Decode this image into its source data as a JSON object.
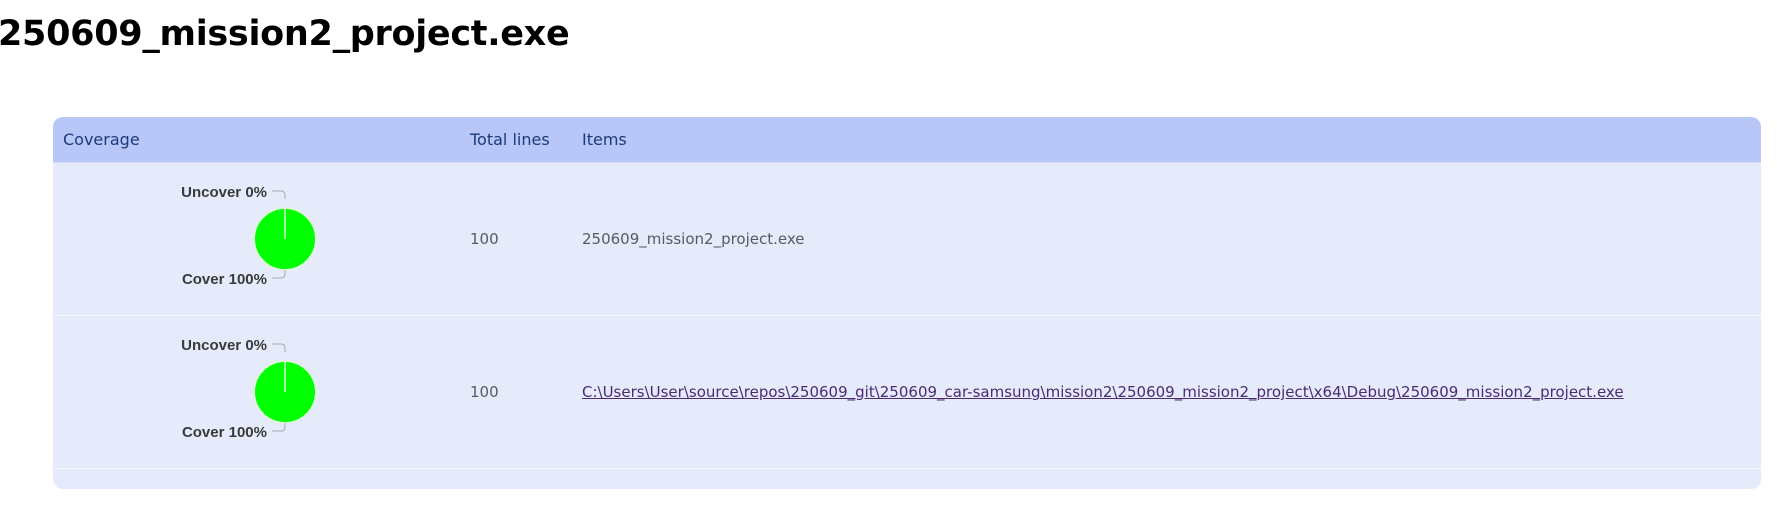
{
  "page": {
    "title": "250609_mission2_project.exe"
  },
  "table": {
    "columns": {
      "coverage": "Coverage",
      "total_lines": "Total lines",
      "items": "Items"
    },
    "rows": [
      {
        "uncover_label": "Uncover 0%",
        "cover_label": "Cover 100%",
        "cover_fraction": 1.0,
        "total_lines": "100",
        "item": "250609_mission2_project.exe",
        "is_link": false
      },
      {
        "uncover_label": "Uncover 0%",
        "cover_label": "Cover 100%",
        "cover_fraction": 1.0,
        "total_lines": "100",
        "item": "C:\\Users\\User\\source\\repos\\250609_git\\250609_car-samsung\\mission2\\250609_mission2_project\\x64\\Debug\\250609_mission2_project.exe",
        "is_link": true
      }
    ]
  },
  "colors": {
    "cover": "#00ff00",
    "uncover": "#ff0000",
    "header_bg": "#b8c6f8",
    "row_bg": "#e6ebfc",
    "link": "#4b2b72"
  }
}
